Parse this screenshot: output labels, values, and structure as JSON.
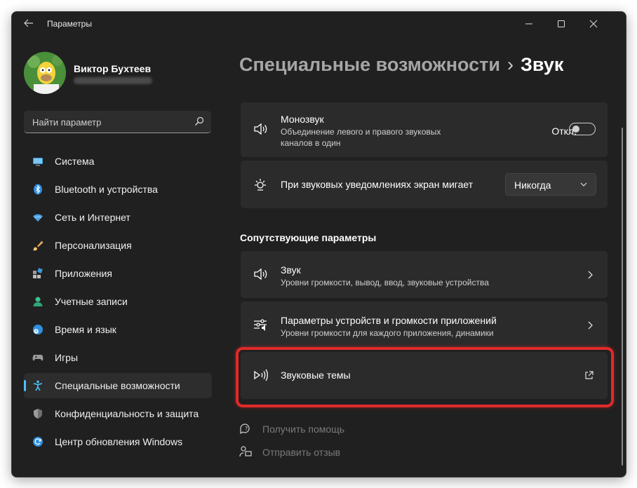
{
  "window": {
    "title": "Параметры"
  },
  "user": {
    "name": "Виктор Бухтеев"
  },
  "search": {
    "placeholder": "Найти параметр"
  },
  "nav": {
    "items": [
      {
        "label": "Система",
        "icon": "monitor-icon"
      },
      {
        "label": "Bluetooth и устройства",
        "icon": "bluetooth-icon"
      },
      {
        "label": "Сеть и Интернет",
        "icon": "wifi-icon"
      },
      {
        "label": "Персонализация",
        "icon": "brush-icon"
      },
      {
        "label": "Приложения",
        "icon": "apps-icon"
      },
      {
        "label": "Учетные записи",
        "icon": "person-icon"
      },
      {
        "label": "Время и язык",
        "icon": "globe-clock-icon"
      },
      {
        "label": "Игры",
        "icon": "gamepad-icon"
      },
      {
        "label": "Специальные возможности",
        "icon": "accessibility-icon"
      },
      {
        "label": "Конфиденциальность и защита",
        "icon": "shield-icon"
      },
      {
        "label": "Центр обновления Windows",
        "icon": "update-icon"
      }
    ],
    "active_index": 8
  },
  "breadcrumb": {
    "parent": "Специальные возможности",
    "separator": "›",
    "current": "Звук"
  },
  "mono": {
    "title": "Монозвук",
    "description": "Объединение левого и правого звуковых каналов в один",
    "state_label": "Откл.",
    "enabled": false
  },
  "flash": {
    "title": "При звуковых уведомлениях экран мигает",
    "selected": "Никогда"
  },
  "related": {
    "title": "Сопутствующие параметры",
    "items": [
      {
        "title": "Звук",
        "description": "Уровни громкости, вывод, ввод, звуковые устройства"
      },
      {
        "title": "Параметры устройств и громкости приложений",
        "description": "Уровни громкости для каждого приложения, динамики"
      },
      {
        "title": "Звуковые темы"
      }
    ]
  },
  "footer": {
    "help": "Получить помощь",
    "feedback": "Отправить отзыв"
  },
  "colors": {
    "accent": "#4cc2ff",
    "highlight": "#e12a2a",
    "window_bg": "#202020",
    "card_bg": "#2b2b2b"
  }
}
